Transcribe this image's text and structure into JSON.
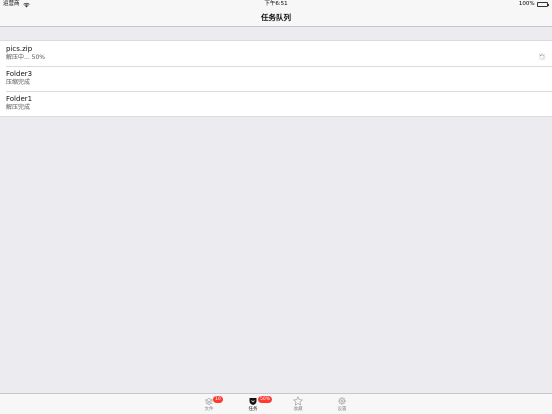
{
  "status_bar": {
    "carrier": "运营商",
    "time": "下午6:51",
    "battery": "100%"
  },
  "nav": {
    "title": "任务队列"
  },
  "tasks": [
    {
      "name": "pics.zip",
      "status": "解压中...  50%",
      "in_progress": true
    },
    {
      "name": "Folder3",
      "status": "压缩完成",
      "in_progress": false
    },
    {
      "name": "Folder1",
      "status": "解压完成",
      "in_progress": false
    }
  ],
  "tabs": [
    {
      "label": "文件",
      "icon": "files-icon",
      "badge": "10",
      "active": false
    },
    {
      "label": "任务",
      "icon": "tasks-icon",
      "badge": "50%",
      "active": true
    },
    {
      "label": "收藏",
      "icon": "star-icon",
      "badge": "",
      "active": false
    },
    {
      "label": "设置",
      "icon": "gear-icon",
      "badge": "",
      "active": false
    }
  ],
  "colors": {
    "badge": "#ff3b30",
    "battery": "#4cd964",
    "background": "#ececf0"
  }
}
